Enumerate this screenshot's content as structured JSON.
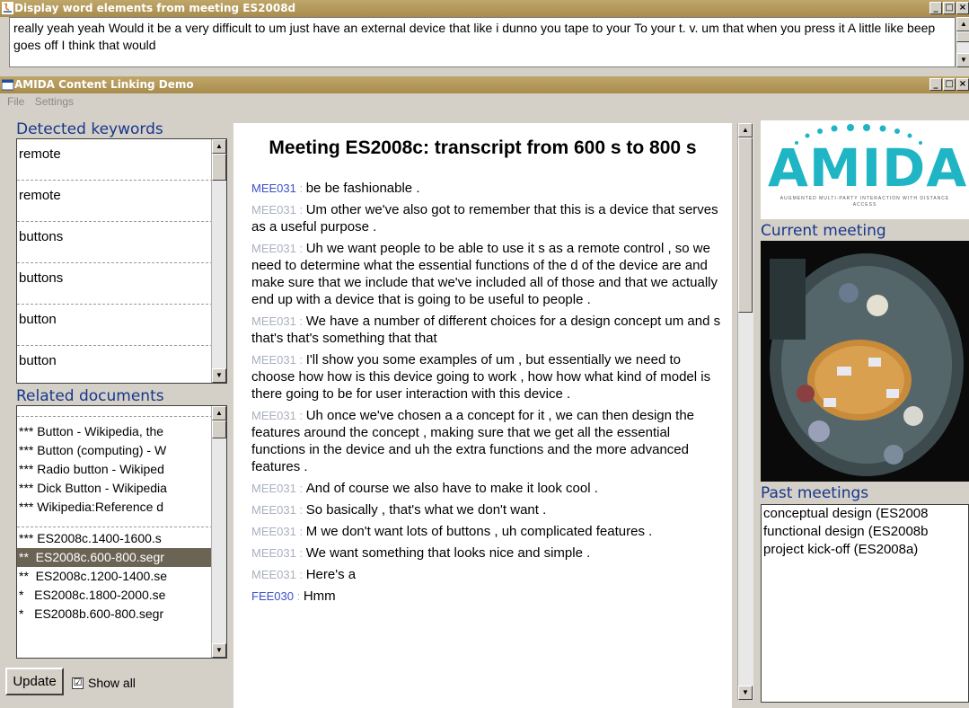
{
  "window1": {
    "title": "Display word elements from meeting ES2008d",
    "text": "really yeah yeah Would it be a very difficult to um just have an external device that like i dunno you tape to your To your t. v. um that when you press it A little like beep goes off I think that would"
  },
  "window2": {
    "title": "AMIDA Content Linking Demo",
    "menu": [
      "File",
      "Settings"
    ]
  },
  "keywords": {
    "title": "Detected keywords",
    "items": [
      "remote",
      "remote",
      "buttons",
      "buttons",
      "button",
      "button"
    ]
  },
  "related": {
    "title": "Related documents",
    "items": [
      {
        "text": "*** Button - Wikipedia, the",
        "selected": false
      },
      {
        "text": "*** Button (computing) - W",
        "selected": false
      },
      {
        "text": "*** Radio button - Wikiped",
        "selected": false
      },
      {
        "text": "*** Dick Button - Wikipedia",
        "selected": false
      },
      {
        "text": "*** Wikipedia:Reference d",
        "selected": false
      }
    ],
    "segments": [
      {
        "text": "*** ES2008c.1400-1600.s",
        "selected": false
      },
      {
        "text": "**  ES2008c.600-800.segr",
        "selected": true
      },
      {
        "text": "**  ES2008c.1200-1400.se",
        "selected": false
      },
      {
        "text": "*   ES2008c.1800-2000.se",
        "selected": false
      },
      {
        "text": "*   ES2008b.600-800.segr",
        "selected": false
      }
    ],
    "update_label": "Update",
    "show_all_label": "Show all",
    "show_all_checked": "☑"
  },
  "transcript": {
    "title": "Meeting ES2008c: transcript from 600 s to 800 s",
    "utterances": [
      {
        "speaker": "MEE031",
        "text": "be be fashionable .",
        "highlight": true
      },
      {
        "speaker": "MEE031",
        "text": "Um other we've also got to remember that this is a device that serves as a useful purpose .",
        "highlight": false
      },
      {
        "speaker": "MEE031",
        "text": "Uh we want people to be able to use it s as a remote control , so we need to determine what the essential functions of the d of the device are and make sure that we include that we've included all of those and that we actually end up with a device that is going to be useful to people .",
        "highlight": false
      },
      {
        "speaker": "MEE031",
        "text": "We have a number of different choices for a design concept um and s that's that's something that that",
        "highlight": false
      },
      {
        "speaker": "MEE031",
        "text": "I'll show you some examples of um , but essentially we need to choose how how is this device going to work , how how what kind of model is there going to be for user interaction with this device .",
        "highlight": false
      },
      {
        "speaker": "MEE031",
        "text": "Uh once we've chosen a a concept for it , we can then design the features around the concept , making sure that we get all the essential functions in the device and uh the extra functions and the more advanced features .",
        "highlight": false
      },
      {
        "speaker": "MEE031",
        "text": "And of course we also have to make it look cool .",
        "highlight": false
      },
      {
        "speaker": "MEE031",
        "text": "So basically , that's what we don't want .",
        "highlight": false
      },
      {
        "speaker": "MEE031",
        "text": "M we don't want lots of buttons , uh complicated features .",
        "highlight": false
      },
      {
        "speaker": "MEE031",
        "text": "We want something that looks nice and simple .",
        "highlight": false
      },
      {
        "speaker": "MEE031",
        "text": "Here's a",
        "highlight": false
      },
      {
        "speaker": "FEE030",
        "text": "Hmm",
        "highlight": true
      }
    ]
  },
  "right": {
    "logo_text": "AMIDA",
    "logo_tagline": "AUGMENTED MULTI-PARTY INTERACTION WITH DISTANCE ACCESS",
    "current_meeting_title": "Current meeting",
    "past_meetings_title": "Past meetings",
    "past_meetings": [
      "conceptual design (ES2008",
      "functional design (ES2008b",
      "project kick-off (ES2008a)"
    ]
  },
  "colors": {
    "section_title": "#17378c",
    "speaker_highlight": "#3b50c8",
    "speaker_dim": "#aab0c0",
    "logo_teal": "#1fb5c4",
    "selected_row": "#6b6455"
  }
}
